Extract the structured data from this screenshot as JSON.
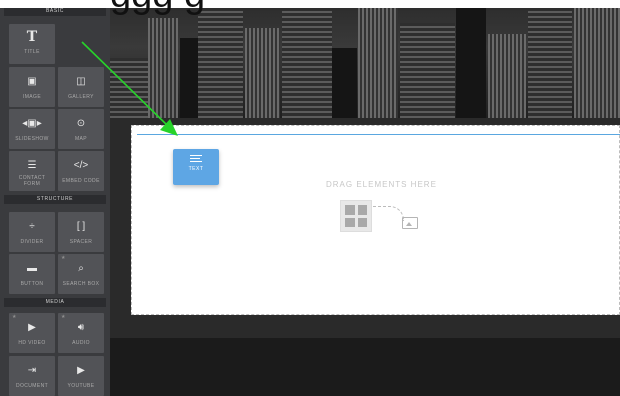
{
  "caption": "ggg g",
  "sidebar": {
    "sections": {
      "basic": "BASIC",
      "structure": "STRUCTURE",
      "media": "MEDIA"
    },
    "items": {
      "title": "TITLE",
      "image": "IMAGE",
      "gallery": "GALLERY",
      "slideshow": "SLIDESHOW",
      "map": "MAP",
      "contact_form_1": "CONTACT",
      "contact_form_2": "FORM",
      "embed_code": "EMBED CODE",
      "divider": "DIVIDER",
      "spacer": "SPACER",
      "button": "BUTTON",
      "search_box": "SEARCH BOX",
      "hd_video": "HD VIDEO",
      "audio": "AUDIO",
      "document": "DOCUMENT",
      "youtube": "YOUTUBE"
    },
    "icons": {
      "title": "T",
      "embed_code": "</>"
    }
  },
  "canvas": {
    "drop_hint": "DRAG ELEMENTS HERE",
    "dragged_element": "TEXT"
  },
  "colors": {
    "accent": "#5ea6e4",
    "arrow": "#27d32a",
    "sidebar": "#3a3b3e"
  }
}
